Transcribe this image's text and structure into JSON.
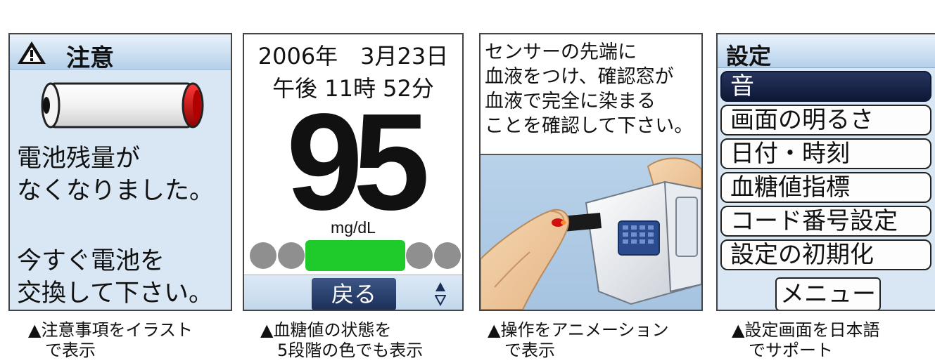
{
  "caution_screen": {
    "title": "注意",
    "battery_message": [
      "電池残量が",
      "なくなりました。"
    ],
    "replace_message": [
      "今すぐ電池を",
      "交換して下さい。"
    ],
    "caption": [
      "▲注意事項をイラスト",
      "　で表示"
    ]
  },
  "glucose_screen": {
    "date": "2006年　3月23日",
    "time": "午後 11時 52分",
    "value": "95",
    "unit": "mg/dL",
    "level_total": 5,
    "level_active": 3,
    "level_color": "#1ecb2a",
    "back_label": "戻る",
    "caption": [
      "▲血糖値の状態を",
      "　5段階の色でも表示"
    ]
  },
  "instruction_screen": {
    "text": [
      "センサーの先端に",
      "血液をつけ、確認窓が",
      "血液で完全に染まる",
      "ことを確認して下さい。"
    ],
    "caption": [
      "▲操作をアニメーション",
      "　で表示"
    ]
  },
  "settings_screen": {
    "title": "設定",
    "items": [
      "音",
      "画面の明るさ",
      "日付・時刻",
      "血糖値指標",
      "コード番号設定",
      "設定の初期化"
    ],
    "menu_label": "メニュー",
    "caption": [
      "▲設定画面を日本語",
      "　でサポート"
    ]
  },
  "colors": {
    "header_blue": "#b5d0ea",
    "selection_navy": "#0e1836",
    "battery_red": "#d01010"
  }
}
